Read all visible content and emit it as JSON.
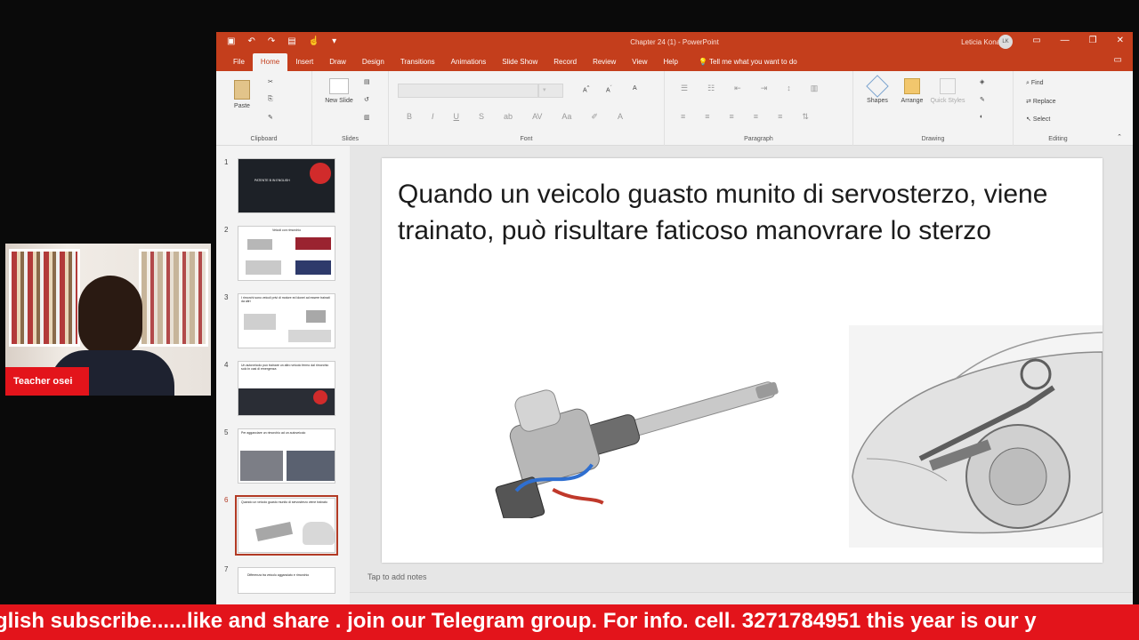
{
  "window": {
    "title": "Chapter 24 (1)  -  PowerPoint",
    "user_name": "Leticia Konadu",
    "user_initials": "LK"
  },
  "tabs": [
    "File",
    "Home",
    "Insert",
    "Draw",
    "Design",
    "Transitions",
    "Animations",
    "Slide Show",
    "Record",
    "Review",
    "View",
    "Help"
  ],
  "tell_me": "Tell me what you want to do",
  "ribbon": {
    "clipboard": {
      "paste": "Paste",
      "label": "Clipboard"
    },
    "slides": {
      "new_slide": "New Slide",
      "label": "Slides"
    },
    "font": {
      "label": "Font"
    },
    "paragraph": {
      "label": "Paragraph"
    },
    "drawing": {
      "shapes": "Shapes",
      "arrange": "Arrange",
      "quick_styles": "Quick Styles",
      "label": "Drawing"
    },
    "editing": {
      "find": "Find",
      "replace": "Replace",
      "select": "Select",
      "label": "Editing"
    }
  },
  "thumbnails": [
    {
      "num": "1",
      "text": "PATENTE B IN ENGLISH"
    },
    {
      "num": "2",
      "text": "Veicoli con rimorchio"
    },
    {
      "num": "3",
      "text": "I rimorchi sono veicoli privi di motore ed idonei ad essere trainati da altri"
    },
    {
      "num": "4",
      "text": "Un autoveicolo può trainare un altro veicolo fermo dal rimorchio solo in casi di emergenza"
    },
    {
      "num": "5",
      "text": "Per agganciare un rimorchio ad un autoveicolo"
    },
    {
      "num": "6",
      "text": "Quando un veicolo guasto munito di servosterzo viene trainato"
    },
    {
      "num": "7",
      "text": "Differenza tra veicolo agganciato e rimorchio"
    }
  ],
  "slide": {
    "title": "Quando un veicolo guasto munito di servosterzo, viene trainato, può risultare faticoso manovrare lo sterzo"
  },
  "notes_placeholder": "Tap to add notes",
  "webcam": {
    "label": "Teacher osei"
  },
  "ticker": {
    "text": "glish subscribe......like and share . join our Telegram group. For info. cell. 3271784951 this year is our y"
  },
  "colors": {
    "ppt_accent": "#c43e1c",
    "ticker_red": "#e3141b"
  }
}
